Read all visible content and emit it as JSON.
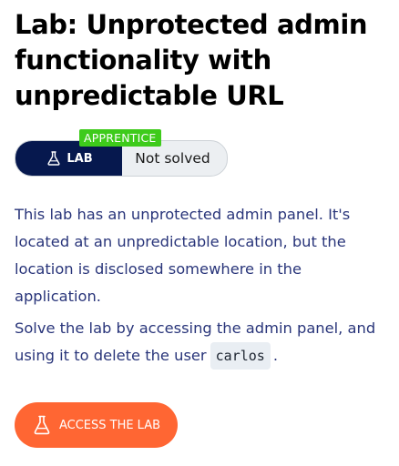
{
  "lab": {
    "title": "Lab: Unprotected admin functionality with unpredictable URL",
    "level_badge": "APPRENTICE",
    "lab_label": "LAB",
    "status": "Not solved"
  },
  "description": {
    "paragraph1": "This lab has an unprotected admin panel. It's located at an unpredictable location, but the location is disclosed somewhere in the application.",
    "paragraph2_before": "Solve the lab by accessing the admin panel, and using it to delete the user",
    "paragraph2_code": "carlos",
    "paragraph2_after": "."
  },
  "actions": {
    "access_label": "ACCESS THE LAB"
  },
  "colors": {
    "badge_green": "#3ecb1b",
    "lab_navy": "#06184e",
    "button_orange": "#ff6633",
    "text_blue": "#29357a"
  },
  "icons": {
    "lab_chip": "flask-icon",
    "access_button": "flask-icon"
  }
}
